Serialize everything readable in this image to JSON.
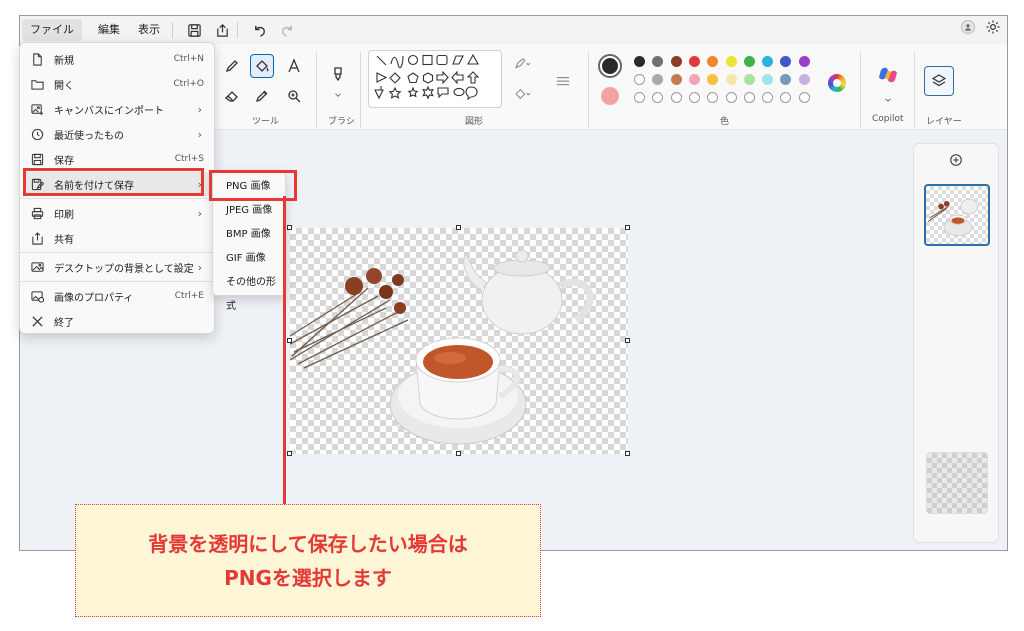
{
  "menubar": {
    "items": [
      "ファイル",
      "編集",
      "表示"
    ]
  },
  "ribbon": {
    "groups": {
      "tools": "ツール",
      "brush": "ブラシ",
      "shapes": "図形",
      "color": "色",
      "copilot": "Copilot",
      "layers": "レイヤー"
    },
    "colors": {
      "primary": "#2a2a2a",
      "secondary": "#f2a4a0",
      "palette_row1": [
        "#2a2a2a",
        "#707070",
        "#8a3e22",
        "#e03a3a",
        "#f0882a",
        "#ece43a",
        "#3cb44a",
        "#2ab3d8",
        "#3f57c8",
        "#9a3fc8"
      ],
      "palette_row2": [
        "",
        "#a9a9a9",
        "#c27c54",
        "#f4a4b4",
        "#f8c040",
        "#f4e8a8",
        "#a8e4a0",
        "#9ee6e6",
        "#7a98b8",
        "#c8b0e0"
      ]
    }
  },
  "file_menu": {
    "items": [
      {
        "label": "新規",
        "shortcut": "Ctrl+N",
        "icon": "new-file-icon",
        "submenu": false
      },
      {
        "label": "開く",
        "shortcut": "Ctrl+O",
        "icon": "folder-open-icon",
        "submenu": false
      },
      {
        "label": "キャンバスにインポート",
        "shortcut": "",
        "icon": "import-image-icon",
        "submenu": true
      },
      {
        "label": "最近使ったもの",
        "shortcut": "",
        "icon": "clock-icon",
        "submenu": true
      },
      {
        "label": "保存",
        "shortcut": "Ctrl+S",
        "icon": "save-icon",
        "submenu": false
      },
      {
        "label": "名前を付けて保存",
        "shortcut": "",
        "icon": "save-as-icon",
        "submenu": true
      },
      {
        "label": "印刷",
        "shortcut": "",
        "icon": "print-icon",
        "submenu": true
      },
      {
        "label": "共有",
        "shortcut": "",
        "icon": "share-icon",
        "submenu": false
      },
      {
        "label": "デスクトップの背景として設定",
        "shortcut": "",
        "icon": "desktop-background-icon",
        "submenu": true
      },
      {
        "label": "画像のプロパティ",
        "shortcut": "Ctrl+E",
        "icon": "image-properties-icon",
        "submenu": false
      },
      {
        "label": "終了",
        "shortcut": "",
        "icon": "close-icon",
        "submenu": false
      }
    ]
  },
  "save_as_submenu": {
    "items": [
      "PNG 画像",
      "JPEG 画像",
      "BMP 画像",
      "GIF 画像",
      "その他の形式"
    ]
  },
  "callout": {
    "line1": "背景を透明にして保存したい場合は",
    "line2": "PNGを選択します"
  }
}
